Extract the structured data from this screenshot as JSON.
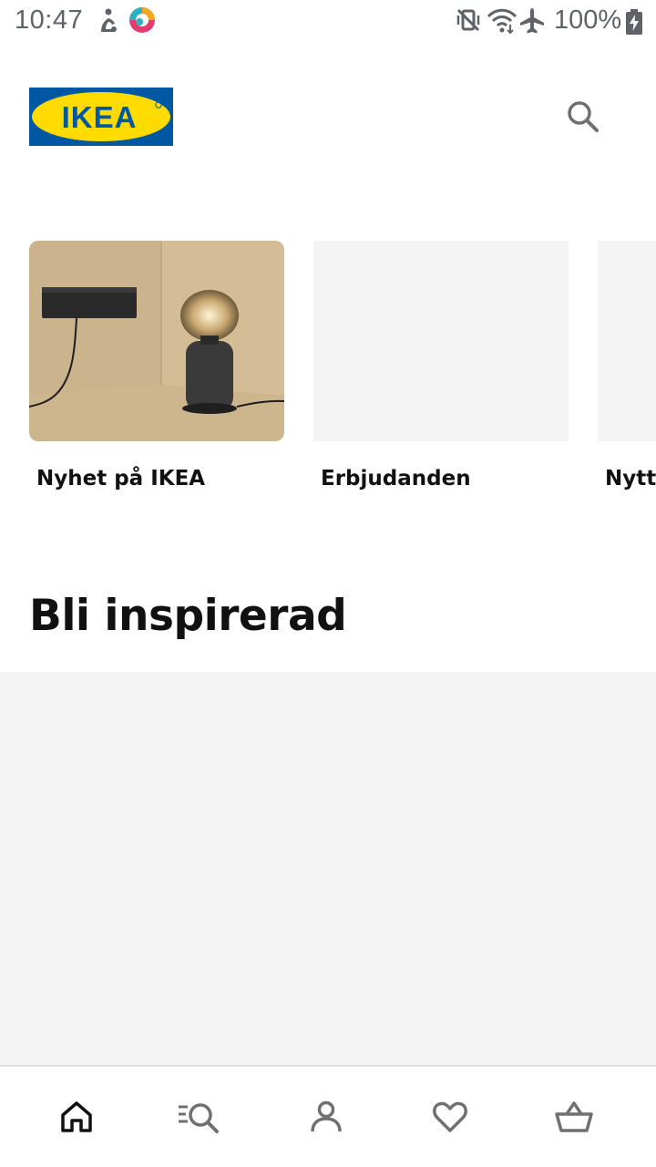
{
  "status_bar": {
    "time": "10:47",
    "battery_percent": "100%",
    "icons": [
      "accessibility-icon",
      "app-notification-icon",
      "vibrate-mute-icon",
      "wifi-icon",
      "airplane-mode-icon",
      "battery-charging-icon"
    ]
  },
  "header": {
    "logo_text": "IKEA",
    "logo_colors": {
      "background": "#0058A3",
      "oval": "#FFDB00",
      "text": "#0058A3"
    },
    "search_icon": "search-icon"
  },
  "categories": [
    {
      "label": "Nyhet på IKEA",
      "image": "speaker-lamp-photo"
    },
    {
      "label": "Erbjudanden",
      "image": "placeholder"
    },
    {
      "label": "Nytt",
      "image": "placeholder"
    }
  ],
  "inspiration": {
    "title": "Bli inspirerad"
  },
  "bottom_nav": {
    "items": [
      {
        "icon": "home-icon",
        "active": true
      },
      {
        "icon": "browse-search-icon",
        "active": false
      },
      {
        "icon": "profile-icon",
        "active": false
      },
      {
        "icon": "heart-icon",
        "active": false
      },
      {
        "icon": "basket-icon",
        "active": false
      }
    ]
  },
  "colors": {
    "text_primary": "#111111",
    "icon_gray": "#707070",
    "placeholder_bg": "#f4f4f4",
    "divider": "#dfdfdf"
  }
}
